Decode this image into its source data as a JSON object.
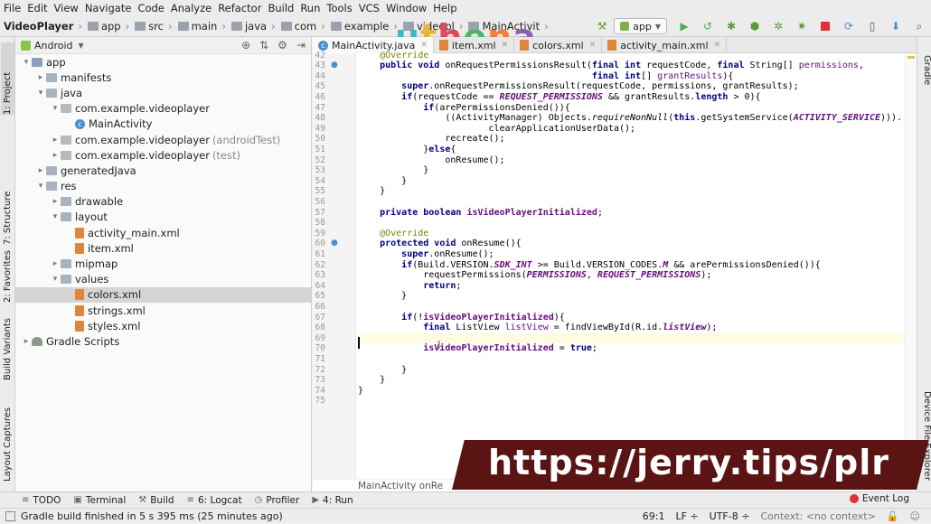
{
  "menu": [
    "File",
    "Edit",
    "View",
    "Navigate",
    "Code",
    "Analyze",
    "Refactor",
    "Build",
    "Run",
    "Tools",
    "VCS",
    "Window",
    "Help"
  ],
  "breadcrumb": [
    "VideoPlayer",
    "app",
    "src",
    "main",
    "java",
    "com",
    "example",
    "videopl",
    "MainActivit"
  ],
  "logo": {
    "u": "u",
    "t": "t",
    "h": "h",
    "e": "e",
    "n": "n",
    "a": "a"
  },
  "toolbar": {
    "run_config": "app"
  },
  "left_tabs": [
    "1: Project",
    "7: Structure",
    "2: Favorites",
    "Build Variants",
    "Layout Captures"
  ],
  "right_tabs": [
    "Gradle",
    "Device File Explorer"
  ],
  "project": {
    "view_mode": "Android",
    "tree": [
      {
        "indent": 0,
        "arrow": "▾",
        "icon": "mod",
        "label": "app",
        "gray": ""
      },
      {
        "indent": 1,
        "arrow": "▸",
        "icon": "folder",
        "label": "manifests",
        "gray": ""
      },
      {
        "indent": 1,
        "arrow": "▾",
        "icon": "folder",
        "label": "java",
        "gray": ""
      },
      {
        "indent": 2,
        "arrow": "▾",
        "icon": "pkg",
        "label": "com.example.videoplayer",
        "gray": ""
      },
      {
        "indent": 3,
        "arrow": "",
        "icon": "cls",
        "label": "MainActivity",
        "gray": ""
      },
      {
        "indent": 2,
        "arrow": "▸",
        "icon": "pkg",
        "label": "com.example.videoplayer",
        "gray": "(androidTest)"
      },
      {
        "indent": 2,
        "arrow": "▸",
        "icon": "pkg",
        "label": "com.example.videoplayer",
        "gray": "(test)"
      },
      {
        "indent": 1,
        "arrow": "▸",
        "icon": "folder",
        "label": "generatedJava",
        "gray": ""
      },
      {
        "indent": 1,
        "arrow": "▾",
        "icon": "folder",
        "label": "res",
        "gray": ""
      },
      {
        "indent": 2,
        "arrow": "▸",
        "icon": "folder",
        "label": "drawable",
        "gray": ""
      },
      {
        "indent": 2,
        "arrow": "▾",
        "icon": "folder",
        "label": "layout",
        "gray": ""
      },
      {
        "indent": 3,
        "arrow": "",
        "icon": "xml",
        "label": "activity_main.xml",
        "gray": ""
      },
      {
        "indent": 3,
        "arrow": "",
        "icon": "xml",
        "label": "item.xml",
        "gray": ""
      },
      {
        "indent": 2,
        "arrow": "▸",
        "icon": "folder",
        "label": "mipmap",
        "gray": ""
      },
      {
        "indent": 2,
        "arrow": "▾",
        "icon": "folder",
        "label": "values",
        "gray": ""
      },
      {
        "indent": 3,
        "arrow": "",
        "icon": "xml",
        "label": "colors.xml",
        "gray": "",
        "selected": true
      },
      {
        "indent": 3,
        "arrow": "",
        "icon": "xml",
        "label": "strings.xml",
        "gray": ""
      },
      {
        "indent": 3,
        "arrow": "",
        "icon": "xml",
        "label": "styles.xml",
        "gray": ""
      },
      {
        "indent": 0,
        "arrow": "▸",
        "icon": "gradle",
        "label": "Gradle Scripts",
        "gray": ""
      }
    ]
  },
  "tabs": [
    {
      "label": "MainActivity.java",
      "icon": "cls",
      "active": true
    },
    {
      "label": "item.xml",
      "icon": "xml",
      "active": false
    },
    {
      "label": "colors.xml",
      "icon": "xml",
      "active": false
    },
    {
      "label": "activity_main.xml",
      "icon": "xml",
      "active": false
    }
  ],
  "editor": {
    "lines": [
      {
        "n": "42",
        "m": "",
        "h": "    <span class=\"an\">@Override</span>"
      },
      {
        "n": "43",
        "m": "●",
        "h": "    <span class=\"kw\">public void</span> onRequestPermissionsResult(<span class=\"kw\">final int</span> requestCode, <span class=\"kw\">final</span> String[] <span class=\"pm\">permissions</span>,"
      },
      {
        "n": "44",
        "m": "",
        "h": "                                           <span class=\"kw\">final int</span>[] <span class=\"pm\">grantResults</span>){"
      },
      {
        "n": "45",
        "m": "",
        "h": "        <span class=\"kw\">super</span>.onRequestPermissionsResult(requestCode, permissions, grantResults);"
      },
      {
        "n": "46",
        "m": "",
        "h": "        <span class=\"kw\">if</span>(requestCode == <span class=\"it\">REQUEST_PERMISSIONS</span> &amp;&amp; grantResults.<span class=\"kw\">length</span> &gt; 0){"
      },
      {
        "n": "47",
        "m": "",
        "h": "            <span class=\"kw\">if</span>(arePermissionsDenied()){"
      },
      {
        "n": "48",
        "m": "",
        "h": "                ((ActivityManager) Objects.<i>requireNonNull</i>(<span class=\"kw\">this</span>.getSystemService(<span class=\"it\">ACTIVITY_SERVICE</span>)))."
      },
      {
        "n": "49",
        "m": "",
        "h": "                        clearApplicationUserData();"
      },
      {
        "n": "50",
        "m": "",
        "h": "                recreate();"
      },
      {
        "n": "51",
        "m": "",
        "h": "            }<span class=\"kw\">else</span>{"
      },
      {
        "n": "52",
        "m": "",
        "h": "                onResume();"
      },
      {
        "n": "53",
        "m": "",
        "h": "            }"
      },
      {
        "n": "54",
        "m": "",
        "h": "        }"
      },
      {
        "n": "55",
        "m": "",
        "h": "    }"
      },
      {
        "n": "56",
        "m": "",
        "h": ""
      },
      {
        "n": "57",
        "m": "",
        "h": "    <span class=\"kw\">private boolean</span> <span class=\"fn\">isVideoPlayerInitialized</span>;"
      },
      {
        "n": "58",
        "m": "",
        "h": ""
      },
      {
        "n": "59",
        "m": "",
        "h": "    <span class=\"an\">@Override</span>"
      },
      {
        "n": "60",
        "m": "●",
        "h": "    <span class=\"kw\">protected void</span> onResume(){"
      },
      {
        "n": "61",
        "m": "",
        "h": "        <span class=\"kw\">super</span>.onResume();"
      },
      {
        "n": "62",
        "m": "",
        "h": "        <span class=\"kw\">if</span>(Build.VERSION.<span class=\"it\">SDK_INT</span> &gt;= Build.VERSION_CODES.<span class=\"it\">M</span> &amp;&amp; arePermissionsDenied()){"
      },
      {
        "n": "63",
        "m": "",
        "h": "            requestPermissions(<span class=\"it\">PERMISSIONS</span>, <span class=\"it\">REQUEST_PERMISSIONS</span>);"
      },
      {
        "n": "64",
        "m": "",
        "h": "            <span class=\"kw\">return</span>;"
      },
      {
        "n": "65",
        "m": "",
        "h": "        }"
      },
      {
        "n": "66",
        "m": "",
        "h": ""
      },
      {
        "n": "67",
        "m": "",
        "h": "        <span class=\"kw\">if</span>(!<span class=\"fn\">isVideoPlayerInitialized</span>){"
      },
      {
        "n": "68",
        "m": "",
        "h": "            <span class=\"kw\">final</span> ListView <span class=\"pm\">listView</span> = findViewById(R.id.<span class=\"it\">listView</span>);"
      },
      {
        "n": "69",
        "m": "",
        "h": "",
        "cur": true
      },
      {
        "n": "70",
        "m": "",
        "h": "            <span class=\"fn\">isVideoPlayerInitialized</span> = <span class=\"kw\">true</span>;"
      },
      {
        "n": "71",
        "m": "",
        "h": ""
      },
      {
        "n": "72",
        "m": "",
        "h": "        }"
      },
      {
        "n": "73",
        "m": "",
        "h": "    }"
      },
      {
        "n": "74",
        "m": "",
        "h": "}"
      },
      {
        "n": "75",
        "m": "",
        "h": ""
      }
    ],
    "breadcrumb": "MainActivity   onRe"
  },
  "banner": "https://jerry.tips/plr",
  "bottom_tools": [
    {
      "icon": "≡",
      "label": "TODO"
    },
    {
      "icon": "▣",
      "label": "Terminal"
    },
    {
      "icon": "⚒",
      "label": "Build"
    },
    {
      "icon": "≡",
      "label": "6: Logcat"
    },
    {
      "icon": "◷",
      "label": "Profiler"
    },
    {
      "icon": "▶",
      "label": "4: Run"
    }
  ],
  "event_log": "Event Log",
  "status": {
    "message": "Gradle build finished in 5 s 395 ms (25 minutes ago)",
    "position": "69:1",
    "line_sep": "LF ÷",
    "encoding": "UTF-8 ÷",
    "context": "Context: <no context>"
  }
}
